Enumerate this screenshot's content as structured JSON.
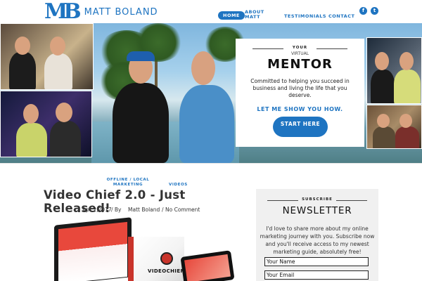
{
  "header": {
    "logo_mark": "MB",
    "logo_text": "MATT BOLAND",
    "nav": {
      "home": "HOME",
      "about": "ABOUT MATT",
      "testimonials": "TESTIMONIALS",
      "contact": "CONTACT"
    },
    "social": {
      "facebook": "f",
      "twitter": "t"
    }
  },
  "hero": {
    "mentor_your": "YOUR",
    "mentor_virtual": "VIRTUAL",
    "mentor_title": "MENTOR",
    "mentor_text": "Committed to helping you succeed in business and living the life that you deserve.",
    "mentor_link": "LET ME SHOW YOU HOW.",
    "cta_label": "START HERE"
  },
  "post": {
    "categories": [
      "OFFLINE / LOCAL MARKETING",
      "VIDEOS"
    ],
    "title": "Video Chief 2.0 - Just Released!",
    "date": "Apr 2,2017",
    "by": "/ By",
    "author": "Matt Boland",
    "separator": "/",
    "comments": "No Comment",
    "product_brand": "VIDEOCHIEF"
  },
  "newsletter": {
    "subscribe": "SUBSCRIBE",
    "title": "NEWSLETTER",
    "text": "I'd love to share more about my online marketing journey with you. Subscribe now and you'll receive access to my newest marketing guide, absolutely free!",
    "name_placeholder": "Your Name",
    "email_placeholder": "Your Email"
  },
  "colors": {
    "brand_blue": "#1e74c1",
    "sidebar_bg": "#f0f0f0"
  }
}
